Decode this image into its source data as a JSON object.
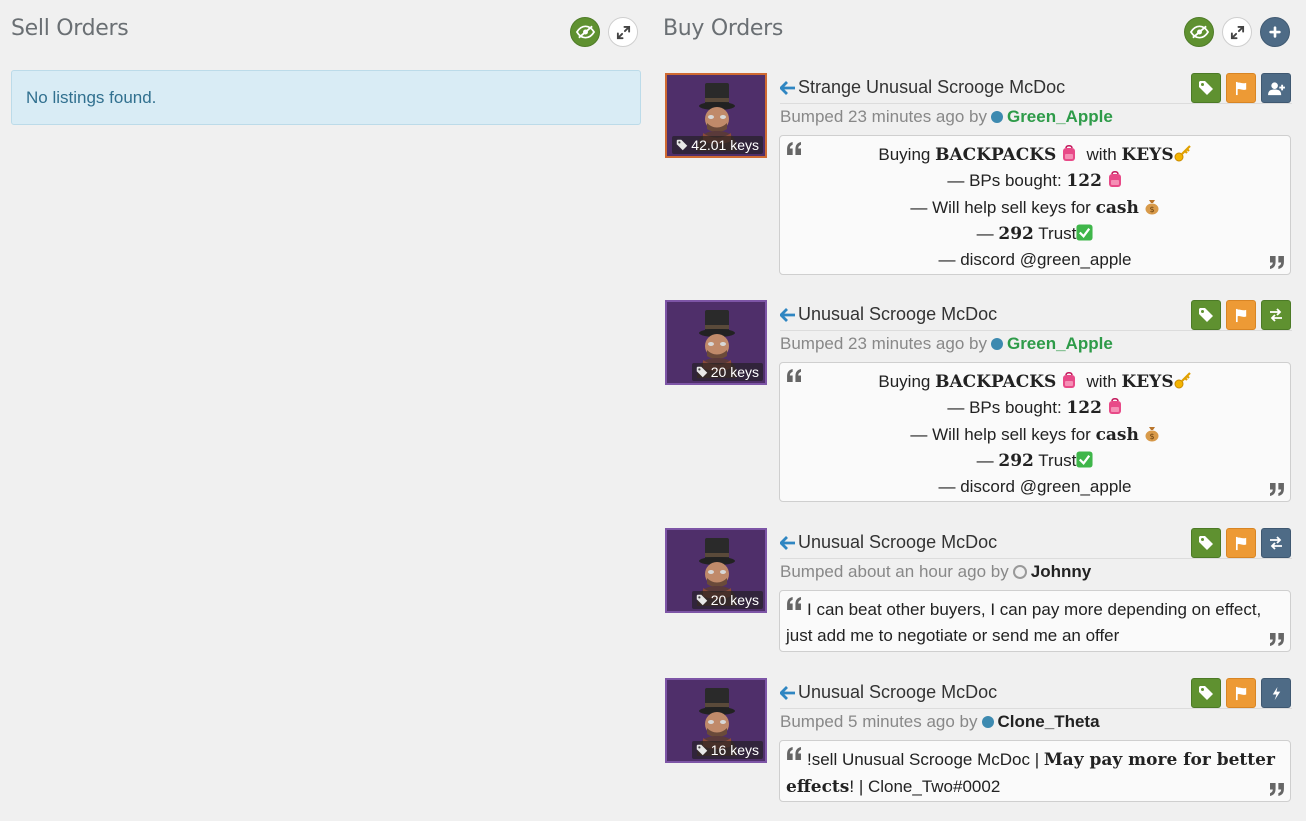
{
  "sell": {
    "title": "Sell Orders",
    "empty_text": "No listings found."
  },
  "buy": {
    "title": "Buy Orders",
    "listings": [
      {
        "name": "Strange Unusual Scrooge McDoc",
        "price": "42.01 keys",
        "bumped": "Bumped 23 minutes ago by",
        "user": "Green_Apple",
        "lines": {
          "l1_a": "Buying",
          "l1_b": "BACKPACKS",
          "l1_c": "with",
          "l1_d": "KEYS",
          "l2_a": "— BPs bought:",
          "l2_b": "122",
          "l3_a": "— Will help sell keys for",
          "l3_b": "cash",
          "l4_a": "—",
          "l4_b": "292",
          "l4_c": "Trust",
          "l5": "— discord @green_apple"
        }
      },
      {
        "name": "Unusual Scrooge McDoc",
        "price": "20 keys",
        "bumped": "Bumped 23 minutes ago by",
        "user": "Green_Apple",
        "lines": {
          "l1_a": "Buying",
          "l1_b": "BACKPACKS",
          "l1_c": "with",
          "l1_d": "KEYS",
          "l2_a": "— BPs bought:",
          "l2_b": "122",
          "l3_a": "— Will help sell keys for",
          "l3_b": "cash",
          "l4_a": "—",
          "l4_b": "292",
          "l4_c": "Trust",
          "l5": "— discord @green_apple"
        }
      },
      {
        "name": "Unusual Scrooge McDoc",
        "price": "20 keys",
        "bumped": "Bumped about an hour ago by",
        "user": "Johnny",
        "message": "I can beat other buyers, I can pay more depending on effect, just add me to negotiate or send me an offer"
      },
      {
        "name": "Unusual Scrooge McDoc",
        "price": "16 keys",
        "bumped": "Bumped 5 minutes ago by",
        "user": "Clone_Theta",
        "msg_a": "!sell Unusual Scrooge McDoc |",
        "msg_b": "May pay more for better effects",
        "msg_c": "! | Clone_Two#0002"
      }
    ]
  },
  "colors": {
    "green_btn": "#5f9130",
    "orange_btn": "#ed9a35",
    "slate_btn": "#4e6b86",
    "unusual_border": "#7d55a6",
    "strange_border": "#cf6a32",
    "link_arrow": "#2f86c2",
    "username_green": "#2e9b49"
  },
  "icons": [
    "eye-slash-icon",
    "expand-icon",
    "plus-icon",
    "tag-icon",
    "flag-icon",
    "add-friend-icon",
    "exchange-icon",
    "bolt-icon",
    "quote-left-icon",
    "quote-right-icon",
    "arrow-left-icon",
    "backpack-emoji",
    "key-emoji",
    "moneybag-emoji",
    "check-emoji"
  ]
}
